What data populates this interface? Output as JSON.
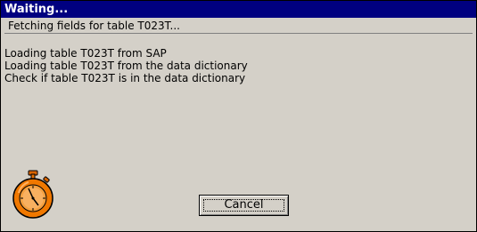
{
  "window": {
    "title": "Waiting..."
  },
  "status": {
    "current": "Fetching fields for table T023T..."
  },
  "log": [
    "Loading table T023T from SAP",
    "Loading table T023T from the data dictionary",
    "Check if table T023T is in the data dictionary"
  ],
  "icon": {
    "name": "stopwatch-icon"
  },
  "buttons": {
    "cancel_label": "Cancel"
  },
  "colors": {
    "titlebar": "#000080",
    "dialog_face": "#d4d0c8",
    "stopwatch": "#f07800"
  }
}
